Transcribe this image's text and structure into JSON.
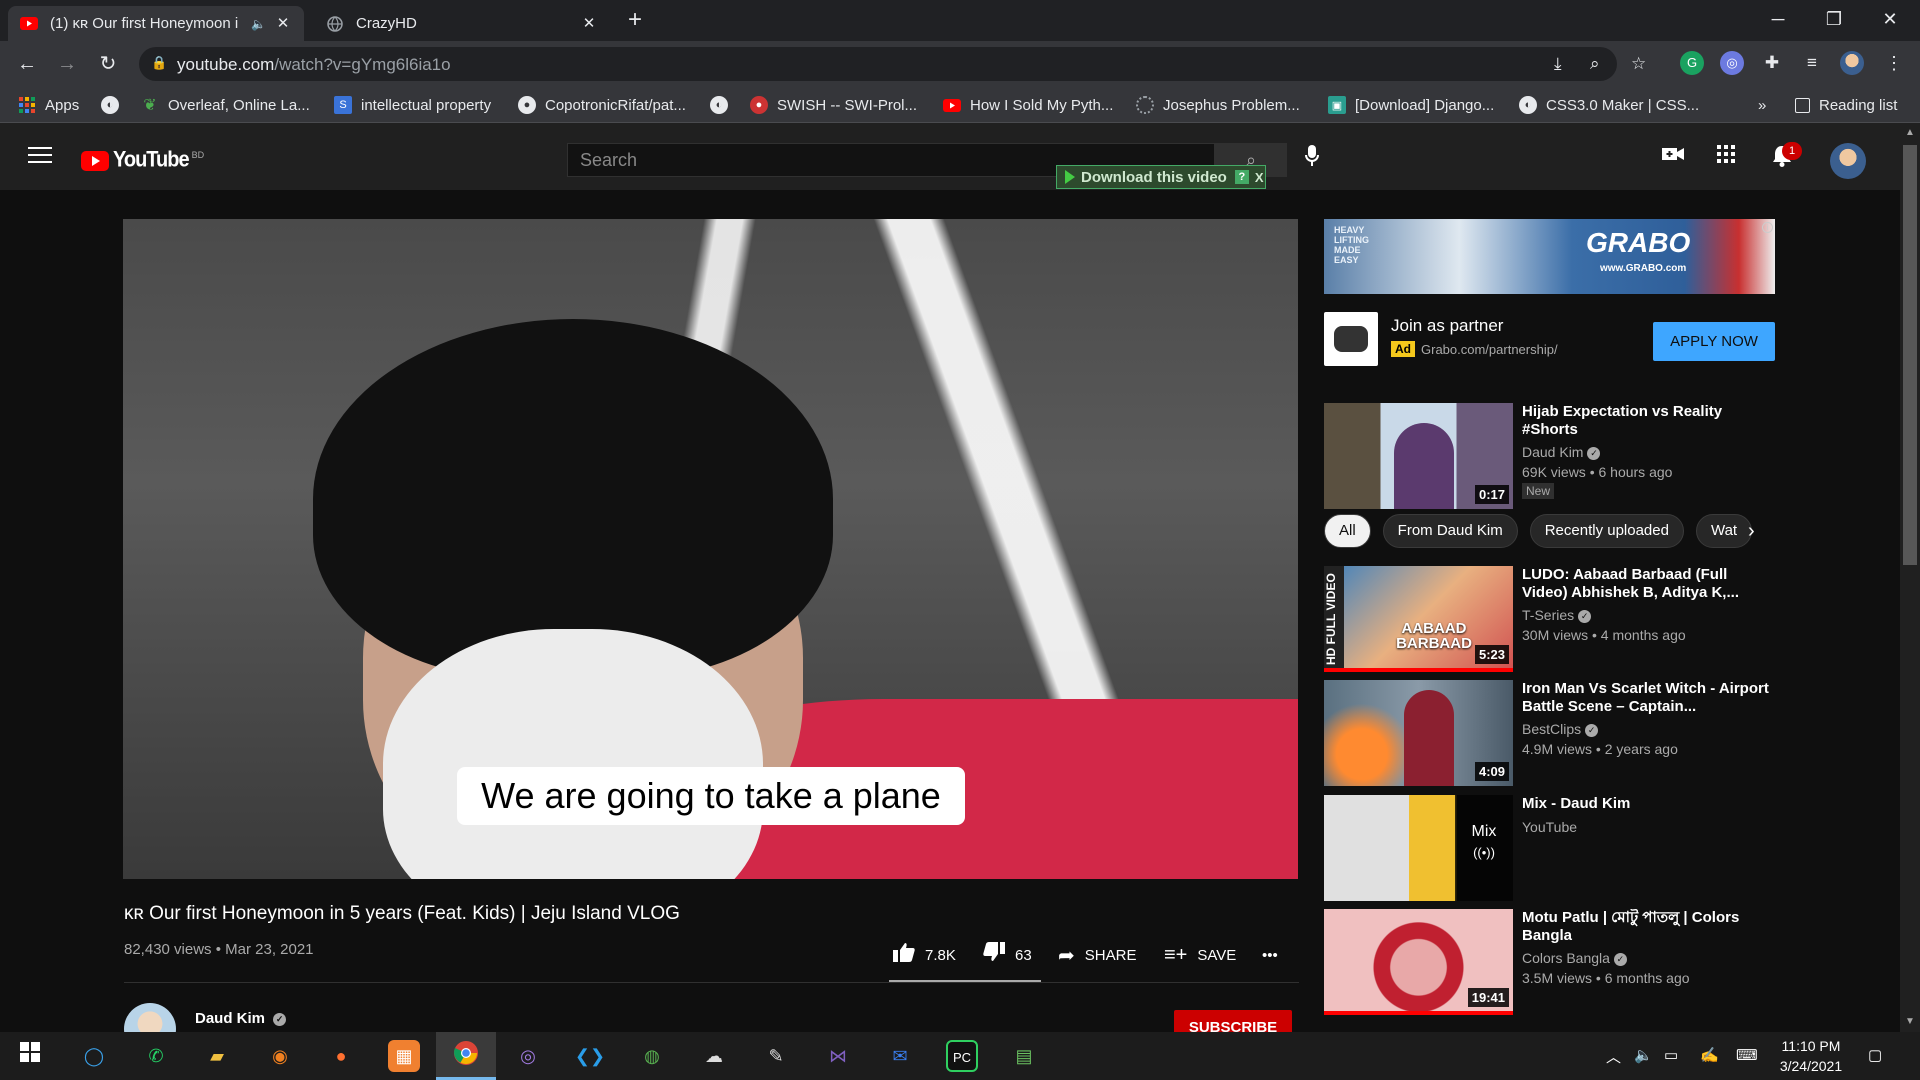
{
  "browser": {
    "tabs": [
      {
        "title": "(1) ĸʀ Our first Honeymoon i",
        "close": "✕",
        "active": true
      },
      {
        "title": "CrazyHD",
        "close": "✕",
        "active": false
      }
    ],
    "new_tab": "+",
    "window_controls": {
      "minimize": "─",
      "restore": "❐",
      "close": "✕"
    },
    "url_host": "youtube.com",
    "url_path": "/watch?v=gYmg6l6ia1o",
    "bookmarks": [
      {
        "label": "Apps",
        "icon": "apps-grid-icon"
      },
      {
        "label": "",
        "icon": "globe-icon"
      },
      {
        "label": "Overleaf, Online La...",
        "icon": "overleaf-icon"
      },
      {
        "label": "intellectual property",
        "icon": "bookmark-s-icon"
      },
      {
        "label": "CopotronicRifat/pat...",
        "icon": "github-icon"
      },
      {
        "label": "",
        "icon": "globe-icon"
      },
      {
        "label": "SWISH -- SWI-Prol...",
        "icon": "swish-icon"
      },
      {
        "label": "How I Sold My Pyth...",
        "icon": "youtube-icon"
      },
      {
        "label": "Josephus Problem...",
        "icon": "loading-icon"
      },
      {
        "label": "[Download] Django...",
        "icon": "download-site-icon"
      },
      {
        "label": "CSS3.0 Maker | CSS...",
        "icon": "globe-icon"
      }
    ],
    "bookmarks_more": "»",
    "reading_list": "Reading list"
  },
  "youtube": {
    "logo_text": "YouTube",
    "country": "BD",
    "search_placeholder": "Search",
    "download_label": "Download this video",
    "download_help": "?",
    "download_close": "X",
    "notification_count": "1",
    "video": {
      "subtitle": "We are going to take a plane",
      "title": "ĸʀ Our first Honeymoon in 5 years (Feat. Kids) | Jeju Island VLOG",
      "meta": "82,430 views • Mar 23, 2021",
      "likes": "7.8K",
      "dislikes": "63",
      "share": "SHARE",
      "save": "SAVE",
      "more": "•••",
      "channel": "Daud Kim",
      "subscribe": "SUBSCRIBE"
    },
    "ad": {
      "banner_brand": "GRABO",
      "banner_url": "www.GRABO.com",
      "banner_tagline": "HEAVY LIFTING MADE EASY",
      "title": "Join as partner",
      "tag": "Ad",
      "url": "Grabo.com/partnership/",
      "cta": "APPLY NOW",
      "info": "i"
    },
    "chips": [
      "All",
      "From Daud Kim",
      "Recently uploaded",
      "Wat"
    ],
    "recommendations": [
      {
        "title": "Hijab Expectation vs Reality #Shorts",
        "channel": "Daud Kim",
        "verified": true,
        "meta": "69K views • 6 hours ago",
        "duration": "0:17",
        "badge": "New"
      },
      {
        "title": "LUDO: Aabaad Barbaad (Full Video) Abhishek B, Aditya K,...",
        "channel": "T-Series",
        "verified": true,
        "meta": "30M views • 4 months ago",
        "duration": "5:23",
        "thumb_text": "AABAAD BARBAAD",
        "side_text": "HD FULL VIDEO",
        "progress": 1.0
      },
      {
        "title": "Iron Man Vs Scarlet Witch - Airport Battle Scene – Captain...",
        "channel": "BestClips",
        "verified": true,
        "meta": "4.9M views • 2 years ago",
        "duration": "4:09"
      },
      {
        "title": "Mix - Daud Kim",
        "channel": "YouTube",
        "verified": false,
        "meta": "",
        "mix_label": "Mix",
        "mix_icon": "((•))"
      },
      {
        "title": "Motu Patlu | মোটু পাতলু | Colors Bangla",
        "channel": "Colors Bangla",
        "verified": true,
        "meta": "3.5M views • 6 months ago",
        "duration": "19:41",
        "progress": 1.0
      }
    ]
  },
  "taskbar": {
    "time": "11:10 PM",
    "date": "3/24/2021"
  }
}
